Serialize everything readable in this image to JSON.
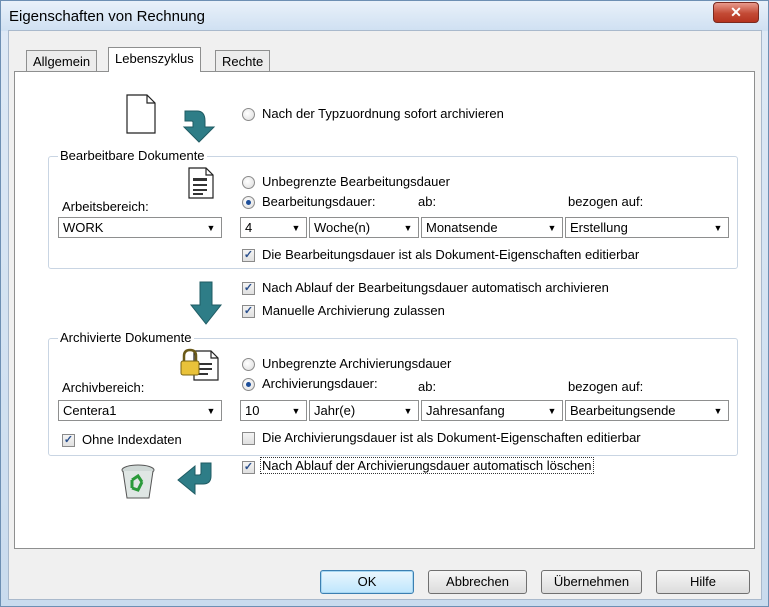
{
  "window": {
    "title": "Eigenschaften von Rechnung",
    "close_label": "✕"
  },
  "tabs": [
    {
      "label": "Allgemein"
    },
    {
      "label": "Lebenszyklus"
    },
    {
      "label": "Rechte"
    }
  ],
  "top": {
    "archive_immediately_label": "Nach der Typzuordnung sofort archivieren"
  },
  "editable": {
    "legend": "Bearbeitbare Dokumente",
    "workspace_label": "Arbeitsbereich:",
    "workspace_value": "WORK",
    "unlimited_label": "Unbegrenzte Bearbeitungsdauer",
    "duration_label": "Bearbeitungsdauer:",
    "from_label": "ab:",
    "relative_label": "bezogen auf:",
    "amount_value": "4",
    "unit_value": "Woche(n)",
    "from_value": "Monatsende",
    "relative_value": "Erstellung",
    "editable_prop_label": "Die Bearbeitungsdauer ist als Dokument-Eigenschaften editierbar"
  },
  "transition": {
    "auto_archive_label": "Nach Ablauf der Bearbeitungsdauer automatisch archivieren",
    "manual_archive_label": "Manuelle Archivierung zulassen"
  },
  "archived": {
    "legend": "Archivierte Dokumente",
    "area_label": "Archivbereich:",
    "area_value": "Centera1",
    "unlimited_label": "Unbegrenzte Archivierungsdauer",
    "duration_label": "Archivierungsdauer:",
    "from_label": "ab:",
    "relative_label": "bezogen auf:",
    "amount_value": "10",
    "unit_value": "Jahr(e)",
    "from_value": "Jahresanfang",
    "relative_value": "Bearbeitungsende",
    "no_index_label": "Ohne Indexdaten",
    "editable_prop_label": "Die Archivierungsdauer ist als Dokument-Eigenschaften editierbar"
  },
  "bottom": {
    "auto_delete_label": "Nach Ablauf der Archivierungsdauer automatisch löschen"
  },
  "buttons": {
    "ok": "OK",
    "cancel": "Abbrechen",
    "apply": "Übernehmen",
    "help": "Hilfe"
  },
  "colors": {
    "arrow": "#2e7d87",
    "accent": "#1e4f9a"
  }
}
